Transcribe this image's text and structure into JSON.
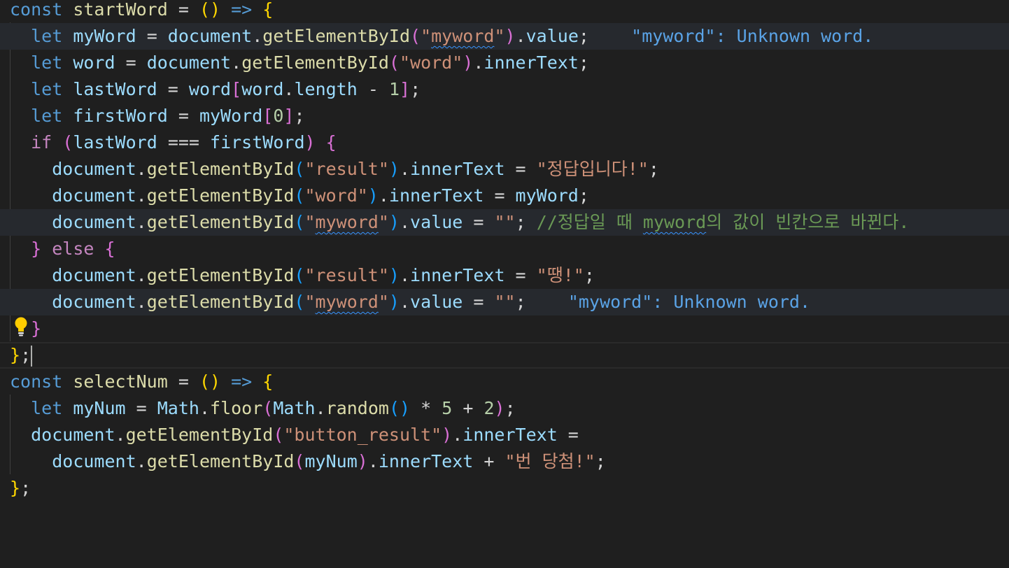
{
  "editor": {
    "lines": [
      [
        [
          "const",
          "kw"
        ],
        [
          " "
        ],
        [
          "startWord",
          "fn"
        ],
        [
          " = ",
          "op"
        ],
        [
          "()",
          "p1"
        ],
        [
          " "
        ],
        [
          "=>",
          "kw"
        ],
        [
          " "
        ],
        [
          "{",
          "p1"
        ]
      ],
      [
        [
          "  "
        ],
        [
          "let",
          "kw"
        ],
        [
          " "
        ],
        [
          "myWord",
          "var"
        ],
        [
          " = ",
          "op"
        ],
        [
          "document",
          "var"
        ],
        [
          "."
        ],
        [
          "getElementById",
          "fn"
        ],
        [
          "(",
          "p2"
        ],
        [
          "\"",
          "str"
        ],
        [
          "myword",
          "str squig"
        ],
        [
          "\"",
          "str"
        ],
        [
          ")",
          "p2"
        ],
        [
          "."
        ],
        [
          "value",
          "var"
        ],
        [
          ";"
        ],
        [
          "    "
        ],
        [
          "\"myword\": Unknown word.",
          "diag"
        ]
      ],
      [
        [
          "  "
        ],
        [
          "let",
          "kw"
        ],
        [
          " "
        ],
        [
          "word",
          "var"
        ],
        [
          " = ",
          "op"
        ],
        [
          "document",
          "var"
        ],
        [
          "."
        ],
        [
          "getElementById",
          "fn"
        ],
        [
          "(",
          "p2"
        ],
        [
          "\"word\"",
          "str"
        ],
        [
          ")",
          "p2"
        ],
        [
          "."
        ],
        [
          "innerText",
          "var"
        ],
        [
          ";"
        ]
      ],
      [
        [
          "  "
        ],
        [
          "let",
          "kw"
        ],
        [
          " "
        ],
        [
          "lastWord",
          "var"
        ],
        [
          " = ",
          "op"
        ],
        [
          "word",
          "var"
        ],
        [
          "[",
          "p2"
        ],
        [
          "word",
          "var"
        ],
        [
          "."
        ],
        [
          "length",
          "var"
        ],
        [
          " - ",
          "op"
        ],
        [
          "1",
          "num"
        ],
        [
          "]",
          "p2"
        ],
        [
          ";"
        ]
      ],
      [
        [
          "  "
        ],
        [
          "let",
          "kw"
        ],
        [
          " "
        ],
        [
          "firstWord",
          "var"
        ],
        [
          " = ",
          "op"
        ],
        [
          "myWord",
          "var"
        ],
        [
          "[",
          "p2"
        ],
        [
          "0",
          "num"
        ],
        [
          "]",
          "p2"
        ],
        [
          ";"
        ]
      ],
      [
        [
          "  "
        ],
        [
          "if",
          "kw2"
        ],
        [
          " "
        ],
        [
          "(",
          "p2"
        ],
        [
          "lastWord",
          "var"
        ],
        [
          " === ",
          "op"
        ],
        [
          "firstWord",
          "var"
        ],
        [
          ")",
          "p2"
        ],
        [
          " "
        ],
        [
          "{",
          "p2"
        ]
      ],
      [
        [
          "    "
        ],
        [
          "document",
          "var"
        ],
        [
          "."
        ],
        [
          "getElementById",
          "fn"
        ],
        [
          "(",
          "p3"
        ],
        [
          "\"result\"",
          "str"
        ],
        [
          ")",
          "p3"
        ],
        [
          "."
        ],
        [
          "innerText",
          "var"
        ],
        [
          " = ",
          "op"
        ],
        [
          "\"정답입니다!\"",
          "str"
        ],
        [
          ";"
        ]
      ],
      [
        [
          "    "
        ],
        [
          "document",
          "var"
        ],
        [
          "."
        ],
        [
          "getElementById",
          "fn"
        ],
        [
          "(",
          "p3"
        ],
        [
          "\"word\"",
          "str"
        ],
        [
          ")",
          "p3"
        ],
        [
          "."
        ],
        [
          "innerText",
          "var"
        ],
        [
          " = ",
          "op"
        ],
        [
          "myWord",
          "var"
        ],
        [
          ";"
        ]
      ],
      [
        [
          "    "
        ],
        [
          "document",
          "var"
        ],
        [
          "."
        ],
        [
          "getElementById",
          "fn"
        ],
        [
          "(",
          "p3"
        ],
        [
          "\"",
          "str"
        ],
        [
          "myword",
          "str squig"
        ],
        [
          "\"",
          "str"
        ],
        [
          ")",
          "p3"
        ],
        [
          "."
        ],
        [
          "value",
          "var"
        ],
        [
          " = ",
          "op"
        ],
        [
          "\"\"",
          "str"
        ],
        [
          "; "
        ],
        [
          "//정답일 때 ",
          "cm"
        ],
        [
          "myword",
          "cm squig"
        ],
        [
          "의 값이 빈칸으로 바뀐다.",
          "cm"
        ]
      ],
      [
        [
          "  "
        ],
        [
          "}",
          "p2"
        ],
        [
          " "
        ],
        [
          "else",
          "kw2"
        ],
        [
          " "
        ],
        [
          "{",
          "p2"
        ]
      ],
      [
        [
          "    "
        ],
        [
          "document",
          "var"
        ],
        [
          "."
        ],
        [
          "getElementById",
          "fn"
        ],
        [
          "(",
          "p3"
        ],
        [
          "\"result\"",
          "str"
        ],
        [
          ")",
          "p3"
        ],
        [
          "."
        ],
        [
          "innerText",
          "var"
        ],
        [
          " = ",
          "op"
        ],
        [
          "\"땡!\"",
          "str"
        ],
        [
          ";"
        ]
      ],
      [
        [
          "    "
        ],
        [
          "document",
          "var"
        ],
        [
          "."
        ],
        [
          "getElementById",
          "fn"
        ],
        [
          "(",
          "p3"
        ],
        [
          "\"",
          "str"
        ],
        [
          "myword",
          "str squig"
        ],
        [
          "\"",
          "str"
        ],
        [
          ")",
          "p3"
        ],
        [
          "."
        ],
        [
          "value",
          "var"
        ],
        [
          " = ",
          "op"
        ],
        [
          "\"\"",
          "str"
        ],
        [
          ";"
        ],
        [
          "    "
        ],
        [
          "\"myword\": Unknown word.",
          "diag"
        ]
      ],
      [
        [
          "  "
        ],
        [
          "}",
          "p2"
        ]
      ],
      [
        [
          "}",
          "p1"
        ],
        [
          ";"
        ]
      ],
      [
        [
          "const",
          "kw"
        ],
        [
          " "
        ],
        [
          "selectNum",
          "fn"
        ],
        [
          " = ",
          "op"
        ],
        [
          "()",
          "p1"
        ],
        [
          " "
        ],
        [
          "=>",
          "kw"
        ],
        [
          " "
        ],
        [
          "{",
          "p1"
        ]
      ],
      [
        [
          "  "
        ],
        [
          "let",
          "kw"
        ],
        [
          " "
        ],
        [
          "myNum",
          "var"
        ],
        [
          " = ",
          "op"
        ],
        [
          "Math",
          "var"
        ],
        [
          "."
        ],
        [
          "floor",
          "fn"
        ],
        [
          "(",
          "p2"
        ],
        [
          "Math",
          "var"
        ],
        [
          "."
        ],
        [
          "random",
          "fn"
        ],
        [
          "()",
          "p3"
        ],
        [
          " * ",
          "op"
        ],
        [
          "5",
          "num"
        ],
        [
          " + ",
          "op"
        ],
        [
          "2",
          "num"
        ],
        [
          ")",
          "p2"
        ],
        [
          ";"
        ]
      ],
      [
        [
          "  "
        ],
        [
          "document",
          "var"
        ],
        [
          "."
        ],
        [
          "getElementById",
          "fn"
        ],
        [
          "(",
          "p2"
        ],
        [
          "\"button_result\"",
          "str"
        ],
        [
          ")",
          "p2"
        ],
        [
          "."
        ],
        [
          "innerText",
          "var"
        ],
        [
          " ="
        ]
      ],
      [
        [
          "    "
        ],
        [
          "document",
          "var"
        ],
        [
          "."
        ],
        [
          "getElementById",
          "fn"
        ],
        [
          "(",
          "p2"
        ],
        [
          "myNum",
          "var"
        ],
        [
          ")",
          "p2"
        ],
        [
          "."
        ],
        [
          "innerText",
          "var"
        ],
        [
          " + ",
          "op"
        ],
        [
          "\"번 당첨!\"",
          "str"
        ],
        [
          ";"
        ]
      ],
      [
        [
          "}",
          "p1"
        ],
        [
          ";"
        ]
      ]
    ]
  },
  "icons": {
    "lightbulb": "lightbulb-icon"
  },
  "colors": {
    "background": "#1f1f1f",
    "line_highlight": "#26292e",
    "keyword": "#569cd6",
    "control": "#c586c0",
    "function": "#dcdcaa",
    "variable": "#9cdcfe",
    "string": "#ce9178",
    "number": "#b5cea8",
    "comment": "#6a9955",
    "diagnostic": "#5aa3e6",
    "squiggle": "#3794ff",
    "bulb": "#ffcc00"
  }
}
